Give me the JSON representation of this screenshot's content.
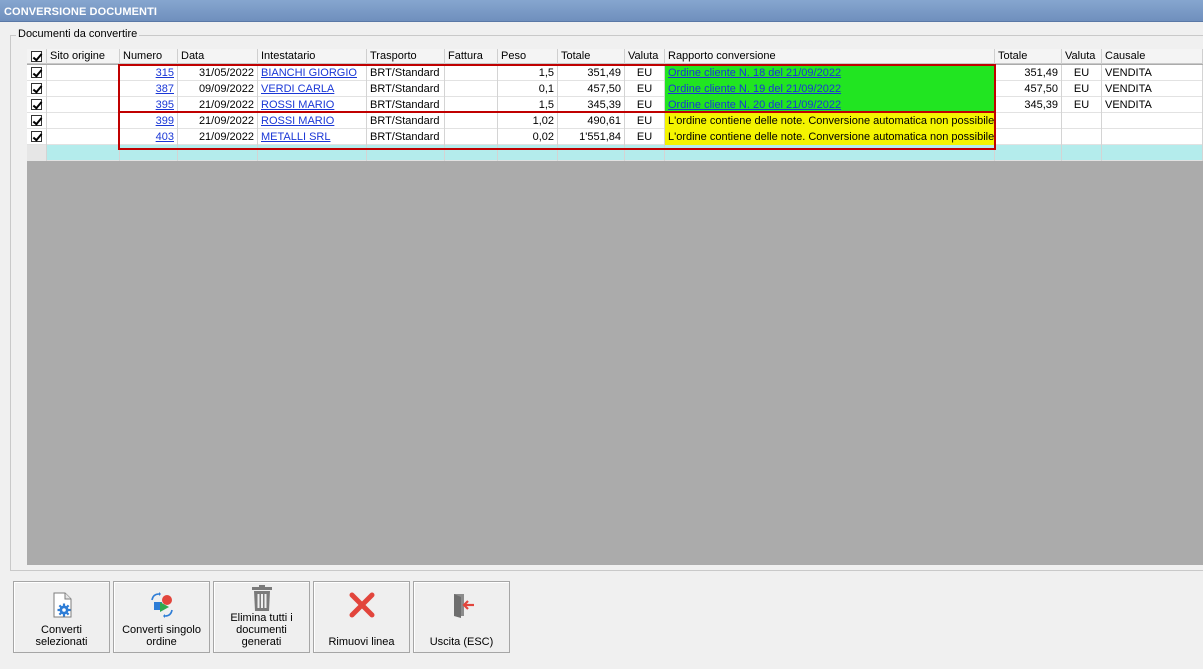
{
  "window": {
    "title": "CONVERSIONE DOCUMENTI"
  },
  "group": {
    "label": "Documenti da convertire"
  },
  "columns": {
    "sito_origine": "Sito origine",
    "numero": "Numero",
    "data": "Data",
    "intestatario": "Intestatario",
    "trasporto": "Trasporto",
    "fattura": "Fattura",
    "peso": "Peso",
    "totale": "Totale",
    "valuta": "Valuta",
    "rapporto": "Rapporto conversione",
    "totale2": "Totale",
    "valuta2": "Valuta",
    "causale": "Causale"
  },
  "rows": [
    {
      "checked": true,
      "sito": "",
      "numero": "315",
      "data": "31/05/2022",
      "intestatario": "BIANCHI GIORGIO",
      "trasporto": "BRT/Standard",
      "fattura": "",
      "peso": "1,5",
      "totale": "351,49",
      "valuta": "EU",
      "rapporto": "Ordine cliente N. 18 del 21/09/2022",
      "stato": "ok",
      "totale2": "351,49",
      "valuta2": "EU",
      "causale": "VENDITA"
    },
    {
      "checked": true,
      "sito": "",
      "numero": "387",
      "data": "09/09/2022",
      "intestatario": "VERDI CARLA",
      "trasporto": "BRT/Standard",
      "fattura": "",
      "peso": "0,1",
      "totale": "457,50",
      "valuta": "EU",
      "rapporto": "Ordine cliente N. 19 del 21/09/2022",
      "stato": "ok",
      "totale2": "457,50",
      "valuta2": "EU",
      "causale": "VENDITA"
    },
    {
      "checked": true,
      "sito": "",
      "numero": "395",
      "data": "21/09/2022",
      "intestatario": "ROSSI MARIO",
      "trasporto": "BRT/Standard",
      "fattura": "",
      "peso": "1,5",
      "totale": "345,39",
      "valuta": "EU",
      "rapporto": "Ordine cliente N. 20 del 21/09/2022",
      "stato": "ok",
      "totale2": "345,39",
      "valuta2": "EU",
      "causale": "VENDITA"
    },
    {
      "checked": true,
      "sito": "",
      "numero": "399",
      "data": "21/09/2022",
      "intestatario": "ROSSI MARIO",
      "trasporto": "BRT/Standard",
      "fattura": "",
      "peso": "1,02",
      "totale": "490,61",
      "valuta": "EU",
      "rapporto": "L'ordine contiene delle note. Conversione automatica non possibile.",
      "stato": "warn",
      "totale2": "",
      "valuta2": "",
      "causale": ""
    },
    {
      "checked": true,
      "sito": "",
      "numero": "403",
      "data": "21/09/2022",
      "intestatario": "METALLI SRL",
      "trasporto": "BRT/Standard",
      "fattura": "",
      "peso": "0,02",
      "totale": "1'551,84",
      "valuta": "EU",
      "rapporto": "L'ordine contiene delle note. Conversione automatica non possibile.",
      "stato": "warn",
      "totale2": "",
      "valuta2": "",
      "causale": ""
    }
  ],
  "buttons": {
    "converti_selezionati": "Converti selezionati",
    "converti_singolo": "Converti singolo ordine",
    "elimina_tutti": "Elimina tutti i documenti generati",
    "rimuovi_linea": "Rimuovi linea",
    "uscita": "Uscita (ESC)"
  },
  "colors": {
    "ok": "#21e521",
    "warn": "#f4f400",
    "highlight_border": "#c00000",
    "new_row": "#b4ecec",
    "link": "#1a37d6"
  },
  "icons": {
    "converti_selezionati": "document-gear-icon",
    "converti_singolo": "shapes-convert-icon",
    "elimina_tutti": "trash-icon",
    "rimuovi_linea": "red-x-icon",
    "uscita": "exit-door-icon"
  }
}
